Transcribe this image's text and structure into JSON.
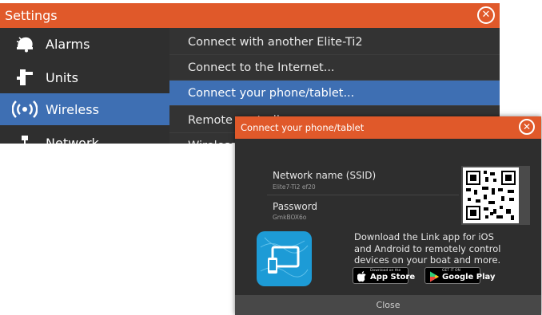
{
  "settings": {
    "title": "Settings",
    "sidebar": [
      {
        "label": "Alarms",
        "icon": "alarm-bell-icon"
      },
      {
        "label": "Units",
        "icon": "units-icon"
      },
      {
        "label": "Wireless",
        "icon": "wireless-icon",
        "selected": true
      },
      {
        "label": "Network",
        "icon": "network-icon"
      }
    ],
    "options": [
      {
        "label": "Connect with another Elite-Ti2"
      },
      {
        "label": "Connect to the Internet..."
      },
      {
        "label": "Connect your phone/tablet...",
        "selected": true
      },
      {
        "label": "Remote controllers"
      },
      {
        "label": "Wireless settings"
      }
    ]
  },
  "dialog": {
    "title": "Connect your phone/tablet",
    "network_name_label": "Network name (SSID)",
    "network_name_value": "Elite7-Ti2 ef20",
    "password_label": "Password",
    "password_value": "GmkBOX6o",
    "promo_text": "Download the Link app for iOS and Android to remotely control devices on your boat and more.",
    "app_store": {
      "small": "Download on the",
      "big": "App Store"
    },
    "google_play": {
      "small": "GET IT ON",
      "big": "Google Play"
    },
    "close_label": "Close"
  },
  "colors": {
    "accent": "#e0592a",
    "selection": "#3e6fb3",
    "app_icon": "#1d9bd6"
  }
}
